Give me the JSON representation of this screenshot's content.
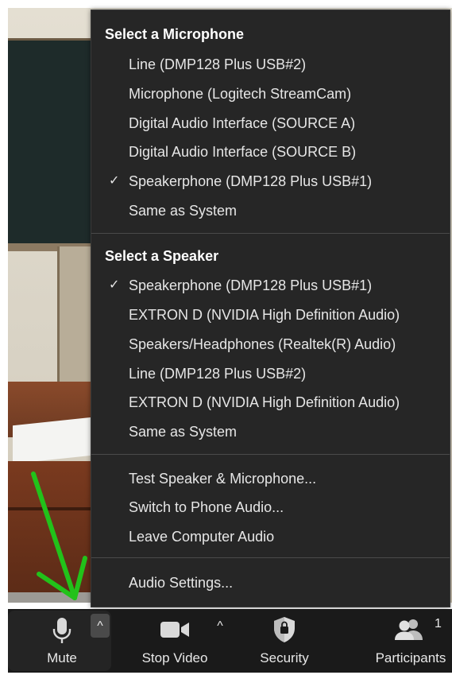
{
  "audio_menu": {
    "microphone": {
      "title": "Select a Microphone",
      "items": [
        {
          "label": "Line (DMP128 Plus USB#2)",
          "checked": false
        },
        {
          "label": "Microphone (Logitech StreamCam)",
          "checked": false
        },
        {
          "label": "Digital Audio Interface (SOURCE A)",
          "checked": false
        },
        {
          "label": "Digital Audio Interface (SOURCE B)",
          "checked": false
        },
        {
          "label": "Speakerphone (DMP128 Plus USB#1)",
          "checked": true
        },
        {
          "label": "Same as System",
          "checked": false
        }
      ]
    },
    "speaker": {
      "title": "Select a Speaker",
      "items": [
        {
          "label": "Speakerphone (DMP128 Plus USB#1)",
          "checked": true
        },
        {
          "label": "EXTRON D (NVIDIA High Definition Audio)",
          "checked": false
        },
        {
          "label": "Speakers/Headphones (Realtek(R) Audio)",
          "checked": false
        },
        {
          "label": "Line (DMP128 Plus USB#2)",
          "checked": false
        },
        {
          "label": "EXTRON D (NVIDIA High Definition Audio)",
          "checked": false
        },
        {
          "label": "Same as System",
          "checked": false
        }
      ]
    },
    "actions": [
      {
        "label": "Test Speaker & Microphone..."
      },
      {
        "label": "Switch to Phone Audio..."
      },
      {
        "label": "Leave Computer Audio"
      }
    ],
    "settings_label": "Audio Settings...",
    "check_glyph": "✓"
  },
  "toolbar": {
    "mute_label": "Mute",
    "stop_video_label": "Stop Video",
    "security_label": "Security",
    "participants_label": "Participants",
    "participants_count": "1",
    "caret_glyph": "^"
  },
  "colors": {
    "menu_bg": "#262626",
    "toolbar_bg": "#1a1a1a",
    "annotation_arrow": "#22c21a"
  }
}
